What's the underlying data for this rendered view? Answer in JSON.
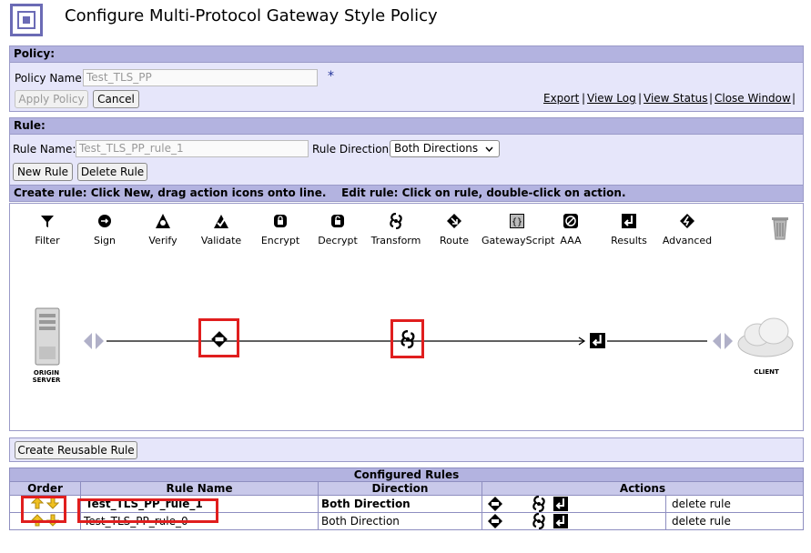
{
  "header": {
    "title": "Configure Multi-Protocol Gateway Style Policy"
  },
  "policy": {
    "section_label": "Policy:",
    "name_label": "Policy Name:",
    "name_value": "Test_TLS_PP",
    "required_mark": "*",
    "apply_label": "Apply Policy",
    "cancel_label": "Cancel",
    "links": [
      "Export",
      "View Log",
      "View Status",
      "Close Window"
    ]
  },
  "rule": {
    "section_label": "Rule:",
    "name_label": "Rule Name:",
    "name_value": "Test_TLS_PP_rule_1",
    "direction_label": "Rule Direction:",
    "direction_value": "Both Directions",
    "new_label": "New Rule",
    "delete_label": "Delete Rule",
    "instructions": "Create rule: Click New, drag action icons onto line.    Edit rule: Click on rule, double-click on action."
  },
  "toolbar": {
    "tools": [
      {
        "label": "Filter",
        "icon": "filter-icon"
      },
      {
        "label": "Sign",
        "icon": "sign-icon"
      },
      {
        "label": "Verify",
        "icon": "verify-icon"
      },
      {
        "label": "Validate",
        "icon": "validate-icon"
      },
      {
        "label": "Encrypt",
        "icon": "encrypt-icon"
      },
      {
        "label": "Decrypt",
        "icon": "decrypt-icon"
      },
      {
        "label": "Transform",
        "icon": "transform-icon"
      },
      {
        "label": "Route",
        "icon": "route-icon"
      },
      {
        "label": "GatewayScript",
        "icon": "gatewayscript-icon"
      },
      {
        "label": "AAA",
        "icon": "aaa-icon"
      },
      {
        "label": "Results",
        "icon": "results-icon"
      },
      {
        "label": "Advanced",
        "icon": "advanced-icon"
      }
    ]
  },
  "canvas": {
    "origin_label_1": "ORIGIN",
    "origin_label_2": "SERVER",
    "client_label": "CLIENT"
  },
  "reusable": {
    "label": "Create Reusable Rule"
  },
  "configured": {
    "caption": "Configured Rules",
    "headers": [
      "Order",
      "Rule Name",
      "Direction",
      "Actions"
    ],
    "rows": [
      {
        "name": "Test_TLS_PP_rule_1",
        "direction": "Both Direction",
        "delete": "delete rule"
      },
      {
        "name": "Test_TLS_PP_rule_0",
        "direction": "Both Direction",
        "delete": "delete rule"
      }
    ]
  },
  "colors": {
    "panel": "#e6e6fa",
    "panel_header": "#b3b3e0",
    "highlight": "#e01e1e",
    "arrow": "#f0c020"
  }
}
